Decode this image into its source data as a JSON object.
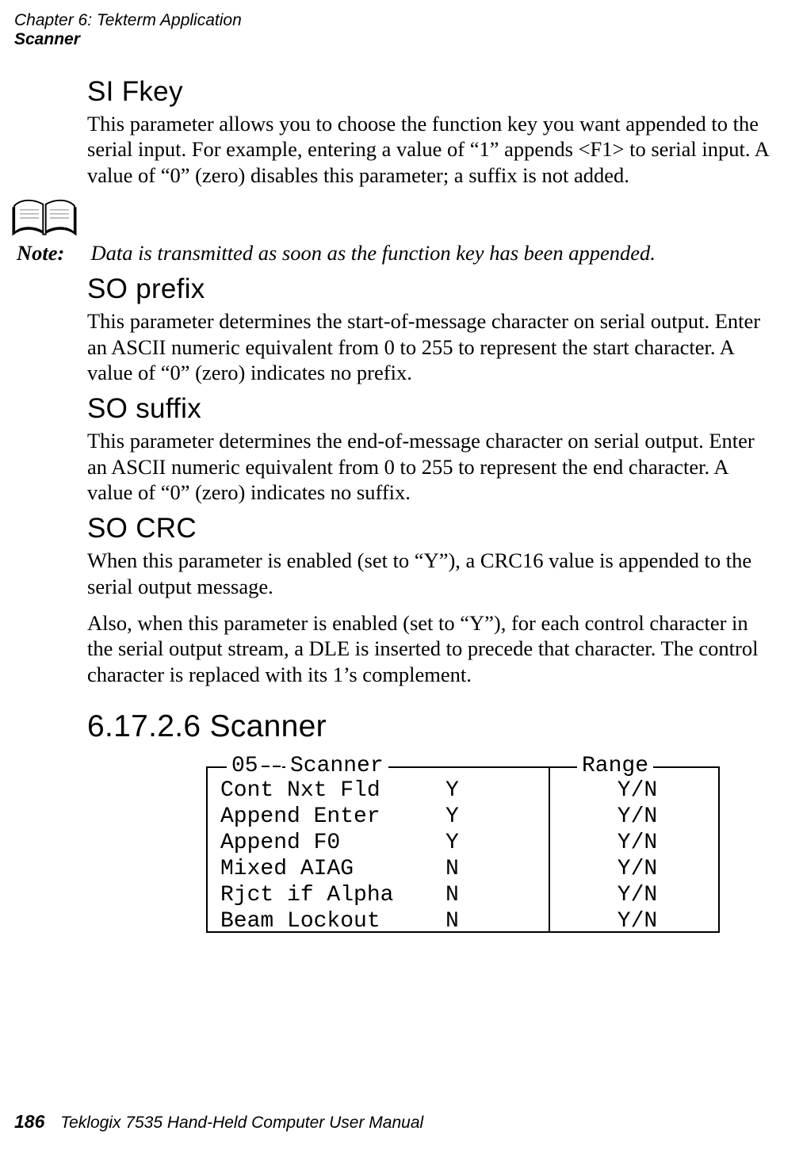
{
  "header": {
    "chapter": "Chapter  6:  Tekterm Application",
    "section": "Scanner"
  },
  "sections": {
    "si_fkey": {
      "title": "SI Fkey",
      "body": "This parameter allows you to choose the function key you want appended to the serial input. For example, entering a value of “1” appends <F1> to serial input. A value of “0” (zero) disables this parameter; a suffix is not added."
    },
    "note": {
      "label": "Note:",
      "msg": "Data is transmitted as soon as the function key has been appended."
    },
    "so_prefix": {
      "title": "SO prefix",
      "body": "This parameter determines the start-of-message character on serial output. Enter an ASCII numeric equivalent from 0 to 255 to represent the start character. A value of “0” (zero) indicates no prefix."
    },
    "so_suffix": {
      "title": "SO suffix",
      "body": "This parameter determines the end-of-message character on serial output. Enter an ASCII numeric equivalent from 0 to 255 to represent the end character. A value of “0” (zero) indicates no suffix."
    },
    "so_crc": {
      "title": "SO CRC",
      "body1": "When this parameter is enabled (set to “Y”), a CRC16 value is appended to the serial output message.",
      "body2": "Also, when this parameter is enabled (set to “Y”), for each control character in the serial output stream, a DLE is inserted to precede that character. The control character is replaced with its 1’s complement."
    },
    "scanner_heading": "6.17.2.6  Scanner"
  },
  "diagram": {
    "legend_num": "05",
    "legend_title": "Scanner",
    "legend_range": "Range",
    "rows": [
      {
        "name": "Cont Nxt Fld",
        "value": "Y",
        "range": "Y/N"
      },
      {
        "name": "Append Enter",
        "value": "Y",
        "range": "Y/N"
      },
      {
        "name": "Append F0",
        "value": "Y",
        "range": "Y/N"
      },
      {
        "name": "Mixed AIAG",
        "value": "N",
        "range": "Y/N"
      },
      {
        "name": "Rjct if Alpha",
        "value": "N",
        "range": "Y/N"
      },
      {
        "name": "Beam Lockout",
        "value": "N",
        "range": "Y/N"
      }
    ]
  },
  "footer": {
    "page": "186",
    "title": "Teklogix 7535 Hand-Held Computer User Manual"
  }
}
